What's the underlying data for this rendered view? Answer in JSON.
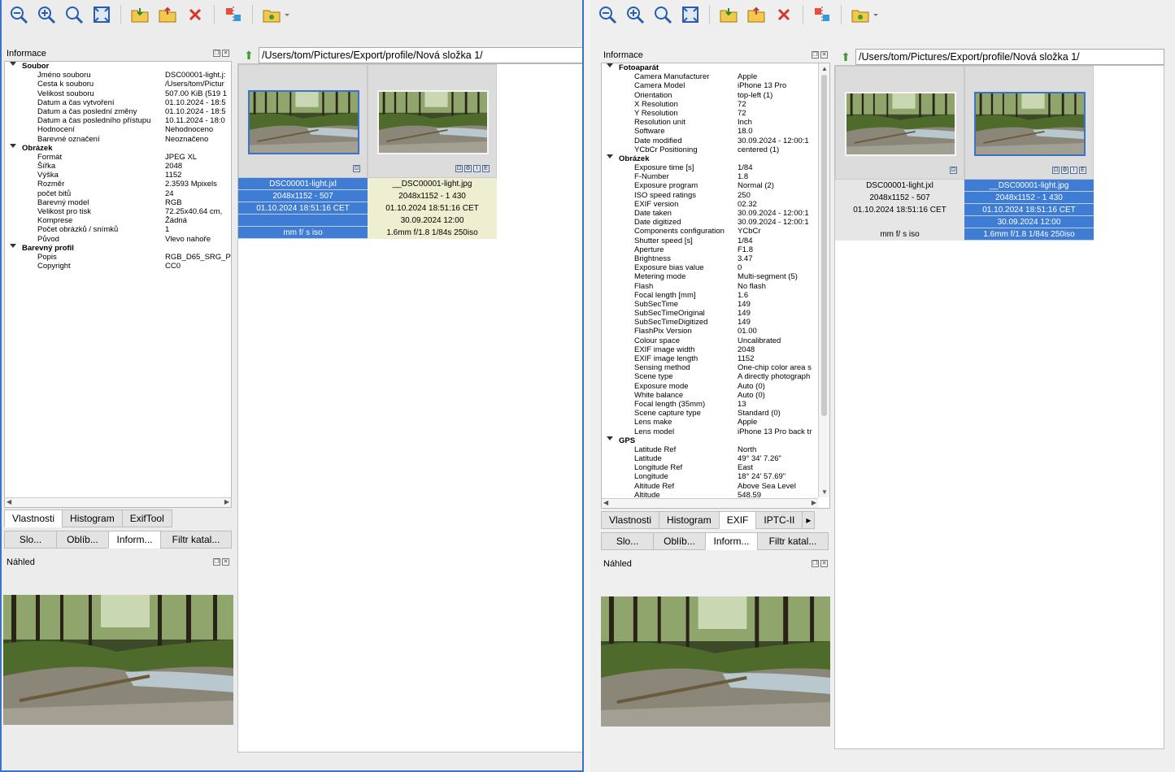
{
  "left": {
    "toolbar": [
      "zoom-out-icon",
      "zoom-in-icon",
      "zoom-fit-icon",
      "fullscreen-icon",
      "open-folder-icon",
      "export-folder-icon",
      "delete-icon",
      "flip-icon",
      "folder-dropdown-icon"
    ],
    "info_title": "Informace",
    "path": "/Users/tom/Pictures/Export/profile/Nová složka 1/",
    "groups": [
      {
        "name": "Soubor",
        "rows": [
          [
            "Jméno souboru",
            "DSC00001-light.j:"
          ],
          [
            "Cesta k souboru",
            "/Users/tom/Pictur"
          ],
          [
            "Velikost souboru",
            "507.00 KiB (519 1"
          ],
          [
            "Datum a čas vytvoření",
            "01.10.2024 - 18:5"
          ],
          [
            "Datum a čas poslední změny",
            "01.10.2024 - 18:5"
          ],
          [
            "Datum a čas posledního přístupu",
            "10.11.2024 - 18:0"
          ],
          [
            "Hodnocení",
            " Nehodnoceno"
          ],
          [
            "Barevné označení",
            " Neoznačeno"
          ]
        ]
      },
      {
        "name": "Obrázek",
        "rows": [
          [
            "Formát",
            "JPEG XL"
          ],
          [
            "Šířka",
            "2048"
          ],
          [
            "Výška",
            "1152"
          ],
          [
            "Rozměr",
            "2.3593 Mpixels"
          ],
          [
            "počet bitů",
            "24"
          ],
          [
            "Barevný model",
            "RGB"
          ],
          [
            "Velikost pro tisk",
            "72.25x40.64 cm,"
          ],
          [
            "Komprese",
            "Žádná"
          ],
          [
            "Počet obrázků / snímků",
            "1"
          ],
          [
            "Původ",
            "Vlevo nahoře"
          ]
        ]
      },
      {
        "name": "Barevný profil",
        "rows": [
          [
            "Popis",
            "RGB_D65_SRG_P"
          ],
          [
            "Copyright",
            "CC0"
          ]
        ]
      }
    ],
    "tabs1": [
      "Vlastnosti",
      "Histogram",
      "ExifTool"
    ],
    "tabs2": [
      "Slo...",
      "Oblíb...",
      "Inform...",
      "Filtr katal..."
    ],
    "preview_title": "Náhled",
    "thumbs": [
      {
        "lines": [
          "DSC00001-light.jxl",
          "2048x1152 - 507",
          "01.10.2024 18:51:16 CET",
          "",
          "mm f/ s iso"
        ],
        "badges": [
          "⊡"
        ],
        "style": "blue",
        "active": true
      },
      {
        "lines": [
          "__DSC00001-light.jpg",
          "2048x1152 - 1  430",
          "01.10.2024 18:51:16 CET",
          "30.09.2024 12:00",
          "1.6mm f/1.8 1/84s 250iso"
        ],
        "badges": [
          "⊡",
          "⚙",
          "I",
          "E"
        ],
        "style": "yellow",
        "active": false
      }
    ]
  },
  "right": {
    "info_title": "Informace",
    "path": "/Users/tom/Pictures/Export/profile/Nová složka 1/",
    "groups": [
      {
        "name": "Fotoaparát",
        "rows": [
          [
            "Camera Manufacturer",
            "Apple"
          ],
          [
            "Camera Model",
            "iPhone 13 Pro"
          ],
          [
            "Orientation",
            "top-left (1)"
          ],
          [
            "X Resolution",
            "72"
          ],
          [
            "Y Resolution",
            "72"
          ],
          [
            "Resolution unit",
            "Inch"
          ],
          [
            "Software",
            "18.0"
          ],
          [
            "Date modified",
            "30.09.2024 - 12:00:1"
          ],
          [
            "YCbCr Positioning",
            "centered (1)"
          ]
        ]
      },
      {
        "name": "Obrázek",
        "rows": [
          [
            "Exposure time [s]",
            "1/84"
          ],
          [
            "F-Number",
            "1.8"
          ],
          [
            "Exposure program",
            "Normal (2)"
          ],
          [
            "ISO speed ratings",
            "250"
          ],
          [
            "EXIF version",
            "02.32"
          ],
          [
            "Date taken",
            "30.09.2024 - 12:00:1"
          ],
          [
            "Date digitized",
            "30.09.2024 - 12:00:1"
          ],
          [
            "Components configuration",
            "YCbCr"
          ],
          [
            "Shutter speed [s]",
            "1/84"
          ],
          [
            "Aperture",
            "F1.8"
          ],
          [
            "Brightness",
            "3.47"
          ],
          [
            "Exposure bias value",
            "0"
          ],
          [
            "Metering mode",
            "Multi-segment (5)"
          ],
          [
            "Flash",
            "No flash"
          ],
          [
            "Focal length [mm]",
            "1.6"
          ],
          [
            "SubSecTime",
            "149"
          ],
          [
            "SubSecTimeOriginal",
            "149"
          ],
          [
            "SubSecTimeDigitized",
            "149"
          ],
          [
            "FlashPix Version",
            "01.00"
          ],
          [
            "Colour space",
            "Uncalibrated"
          ],
          [
            "EXIF image width",
            "2048"
          ],
          [
            "EXIF image length",
            "1152"
          ],
          [
            "Sensing method",
            "One-chip color area s"
          ],
          [
            "Scene type",
            "A directly photograph"
          ],
          [
            "Exposure mode",
            "Auto (0)"
          ],
          [
            "White balance",
            "Auto (0)"
          ],
          [
            "Focal length (35mm)",
            "13"
          ],
          [
            "Scene capture type",
            "Standard (0)"
          ],
          [
            "Lens make",
            "Apple"
          ],
          [
            "Lens model",
            "iPhone 13 Pro back tr"
          ]
        ]
      },
      {
        "name": "GPS",
        "rows": [
          [
            "Latitude Ref",
            "North"
          ],
          [
            "Latitude",
            "49° 34' 7.26\""
          ],
          [
            "Longitude Ref",
            "East"
          ],
          [
            "Longitude",
            "18° 24' 57.69\""
          ],
          [
            "Altitude Ref",
            "Above Sea Level"
          ],
          [
            "Altitude",
            "548.59"
          ]
        ]
      }
    ],
    "tabs1": [
      "Vlastnosti",
      "Histogram",
      "EXIF",
      "IPTC-II"
    ],
    "tabs2": [
      "Slo...",
      "Oblíb...",
      "Inform...",
      "Filtr katal..."
    ],
    "preview_title": "Náhled",
    "thumbs": [
      {
        "lines": [
          "DSC00001-light.jxl",
          "2048x1152 - 507",
          "01.10.2024 18:51:16 CET",
          "",
          "mm f/ s iso"
        ],
        "badges": [
          "⊡"
        ],
        "style": "grey",
        "active": false
      },
      {
        "lines": [
          "__DSC00001-light.jpg",
          "2048x1152 - 1  430",
          "01.10.2024 18:51:16 CET",
          "30.09.2024 12:00",
          "1.6mm f/1.8 1/84s 250iso"
        ],
        "badges": [
          "⊡",
          "⚙",
          "I",
          "E"
        ],
        "style": "blue",
        "active": true
      }
    ]
  }
}
